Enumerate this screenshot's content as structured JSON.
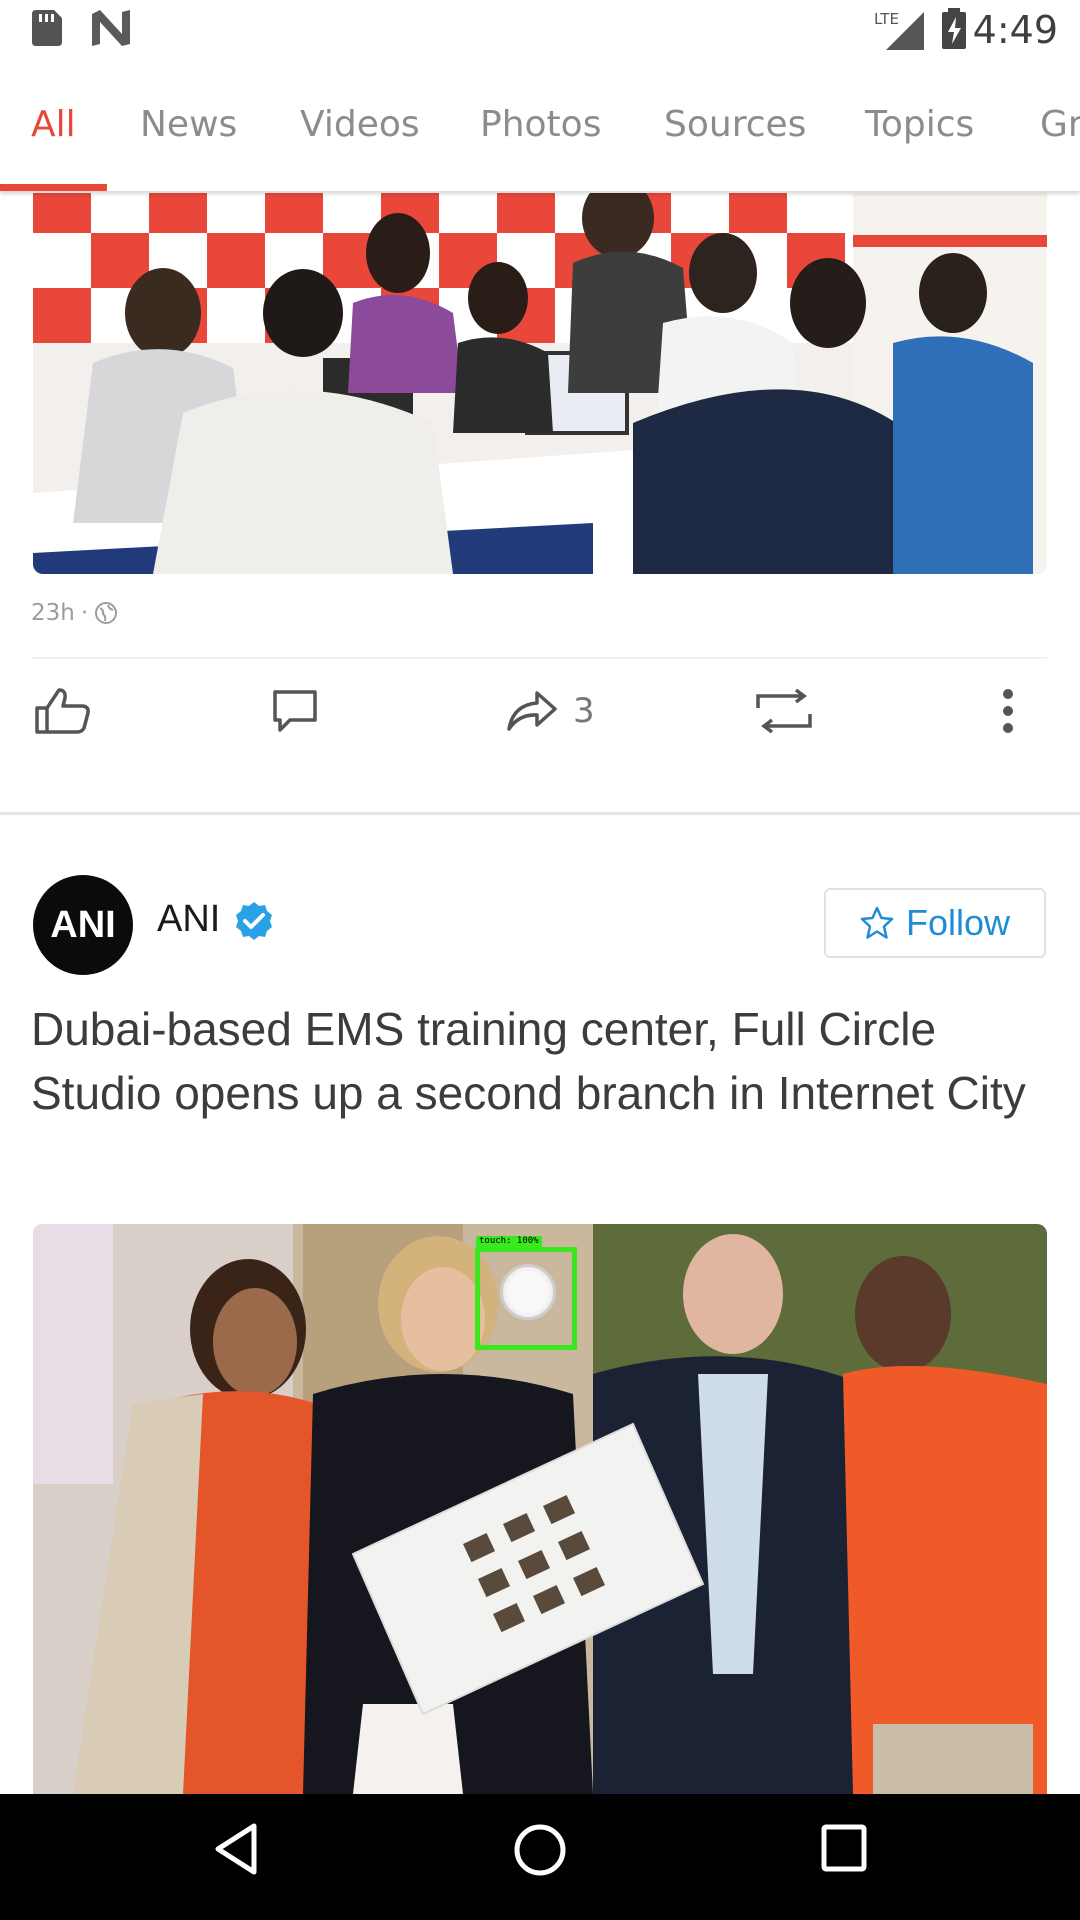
{
  "status_bar": {
    "time": "4:49",
    "network": "LTE",
    "icons": [
      "sd-card-icon",
      "n-notification-icon",
      "lte-signal-icon",
      "battery-charging-icon"
    ]
  },
  "tabs": [
    {
      "label": "All",
      "active": true
    },
    {
      "label": "News",
      "active": false
    },
    {
      "label": "Videos",
      "active": false
    },
    {
      "label": "Photos",
      "active": false
    },
    {
      "label": "Sources",
      "active": false
    },
    {
      "label": "Topics",
      "active": false
    },
    {
      "label": "Gr",
      "active": false
    }
  ],
  "post1": {
    "time_ago": "23h",
    "separator": "·",
    "share_count": "3",
    "actions": [
      "like-icon",
      "comment-icon",
      "share-icon",
      "repost-icon",
      "more-vert-icon"
    ]
  },
  "post2": {
    "avatar_text": "ANI",
    "source": "ANI",
    "verified": true,
    "follow_label": "Follow",
    "headline": "Dubai-based EMS training center, Full Circle Studio opens up a second branch in Internet City"
  },
  "touch_overlay": {
    "label": "touch: 100%"
  },
  "colors": {
    "accent": "#e8473a",
    "follow_blue": "#1f8dd6",
    "verified_blue": "#2aa1e6",
    "touch_green": "#39e81f"
  },
  "nav": [
    "back-icon",
    "home-icon",
    "recents-icon"
  ]
}
